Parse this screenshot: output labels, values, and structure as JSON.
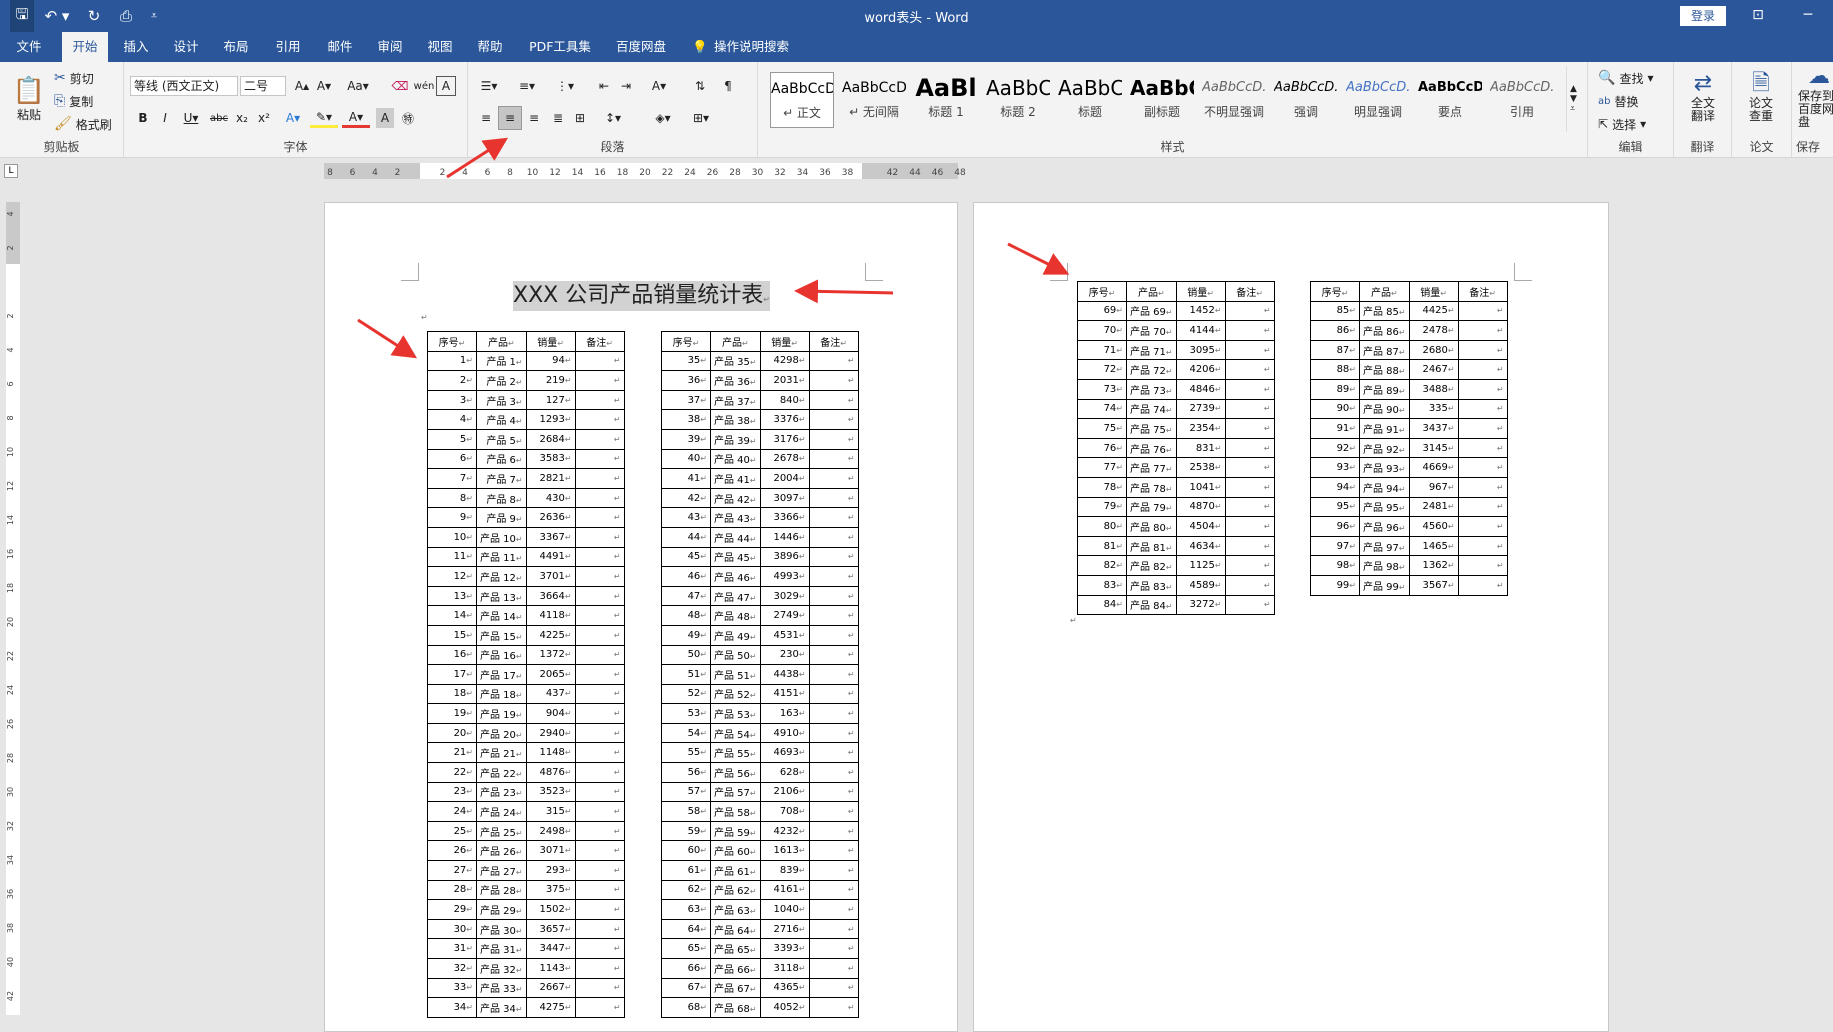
{
  "window": {
    "title": "word表头  -  Word",
    "login": "登录"
  },
  "menu": [
    "文件",
    "开始",
    "插入",
    "设计",
    "布局",
    "引用",
    "邮件",
    "审阅",
    "视图",
    "帮助",
    "PDF工具集",
    "百度网盘",
    "操作说明搜索"
  ],
  "clipboard": {
    "paste": "粘贴",
    "cut": "剪切",
    "copy": "复制",
    "format_painter": "格式刷",
    "label": "剪贴板"
  },
  "font": {
    "name": "等线 (西文正文)",
    "size": "二号",
    "label": "字体"
  },
  "paragraph": {
    "label": "段落"
  },
  "styles": {
    "label": "样式",
    "items": [
      {
        "preview": "AaBbCcDı",
        "name": "↵ 正文"
      },
      {
        "preview": "AaBbCcDı",
        "name": "↵ 无间隔"
      },
      {
        "preview": "AaBl",
        "name": "标题 1"
      },
      {
        "preview": "AaBbC",
        "name": "标题 2"
      },
      {
        "preview": "AaBbC",
        "name": "标题"
      },
      {
        "preview": "AaBbC",
        "name": "副标题"
      },
      {
        "preview": "AaBbCcD.",
        "name": "不明显强调"
      },
      {
        "preview": "AaBbCcD.",
        "name": "强调"
      },
      {
        "preview": "AaBbCcD.",
        "name": "明显强调"
      },
      {
        "preview": "AaBbCcD.",
        "name": "要点"
      },
      {
        "preview": "AaBbCcD.",
        "name": "引用"
      }
    ]
  },
  "editing": {
    "find": "查找",
    "replace": "替换",
    "select": "选择",
    "label": "编辑"
  },
  "translate": {
    "full": "全文翻译",
    "label": "翻译"
  },
  "paper": {
    "check": "论文查重",
    "label": "论文"
  },
  "save": {
    "btn": "保存到百度网盘",
    "label": "保存"
  },
  "ruler": {
    "h": [
      "8",
      "6",
      "4",
      "2",
      "",
      "2",
      "4",
      "6",
      "8",
      "10",
      "12",
      "14",
      "16",
      "18",
      "20",
      "22",
      "24",
      "26",
      "28",
      "30",
      "32",
      "34",
      "36",
      "38",
      "",
      "42",
      "44",
      "46",
      "48"
    ],
    "v": [
      "4",
      "2",
      "",
      "2",
      "4",
      "6",
      "8",
      "10",
      "12",
      "14",
      "16",
      "18",
      "20",
      "22",
      "24",
      "26",
      "28",
      "30",
      "32",
      "34",
      "36",
      "38",
      "40",
      "42"
    ]
  },
  "doc_title": "XXX 公司产品销量统计表",
  "table_headers": [
    "序号",
    "产品",
    "销量",
    "备注"
  ],
  "product_prefix": "产品 ",
  "sales": [
    94,
    219,
    127,
    1293,
    2684,
    3583,
    2821,
    430,
    2636,
    3367,
    4491,
    3701,
    3664,
    4118,
    4225,
    1372,
    2065,
    437,
    904,
    2940,
    1148,
    4876,
    3523,
    315,
    2498,
    3071,
    293,
    375,
    1502,
    3657,
    3447,
    1143,
    2667,
    4275,
    4298,
    2031,
    840,
    3376,
    3176,
    2678,
    2004,
    3097,
    3366,
    1446,
    3896,
    4993,
    3029,
    2749,
    4531,
    230,
    4438,
    4151,
    163,
    4910,
    4693,
    628,
    2106,
    708,
    4232,
    1613,
    839,
    4161,
    1040,
    2716,
    3393,
    3118,
    4365,
    4052,
    1452,
    4144,
    3095,
    4206,
    4846,
    2739,
    2354,
    831,
    2538,
    1041,
    4870,
    4504,
    4634,
    1125,
    4589,
    3272,
    4425,
    2478,
    2680,
    2467,
    3488,
    335,
    3437,
    3145,
    4669,
    967,
    2481,
    4560,
    1465,
    1362,
    3567
  ],
  "colors": {
    "brand": "#2b579a",
    "arrow": "#e8342f"
  }
}
